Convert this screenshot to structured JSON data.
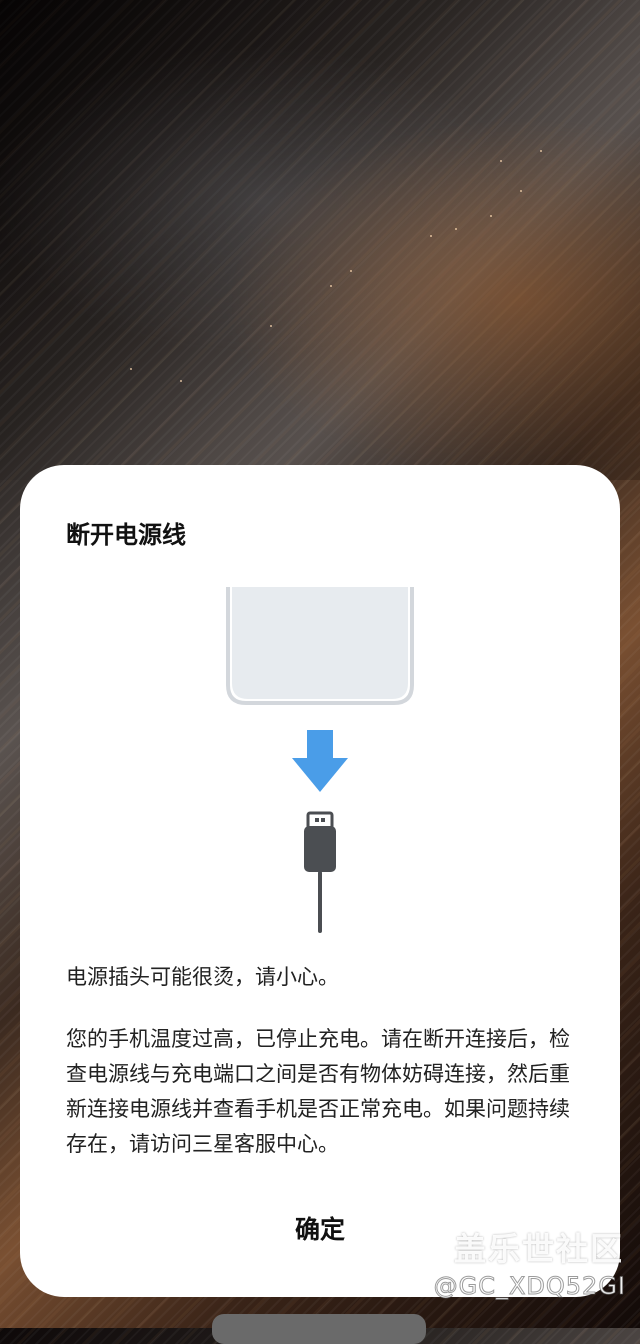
{
  "dialog": {
    "title": "断开电源线",
    "warning": "电源插头可能很烫，请小心。",
    "message": "您的手机温度过高，已停止充电。请在断开连接后，检查电源线与充电端口之间是否有物体妨碍连接，然后重新连接电源线并查看手机是否正常充电。如果问题持续存在，请访问三星客服中心。",
    "confirm_label": "确定"
  },
  "illustration": {
    "icons": [
      "phone-icon",
      "arrow-down-icon",
      "usb-plug-icon"
    ],
    "arrow_color": "#4a9de8",
    "phone_fill": "#e7ebef",
    "phone_stroke": "#d3d7dc",
    "plug_color": "#4b4e52"
  },
  "watermark": {
    "logo_text": "盖乐世社区",
    "handle": "@GC_XDQ52GI"
  }
}
